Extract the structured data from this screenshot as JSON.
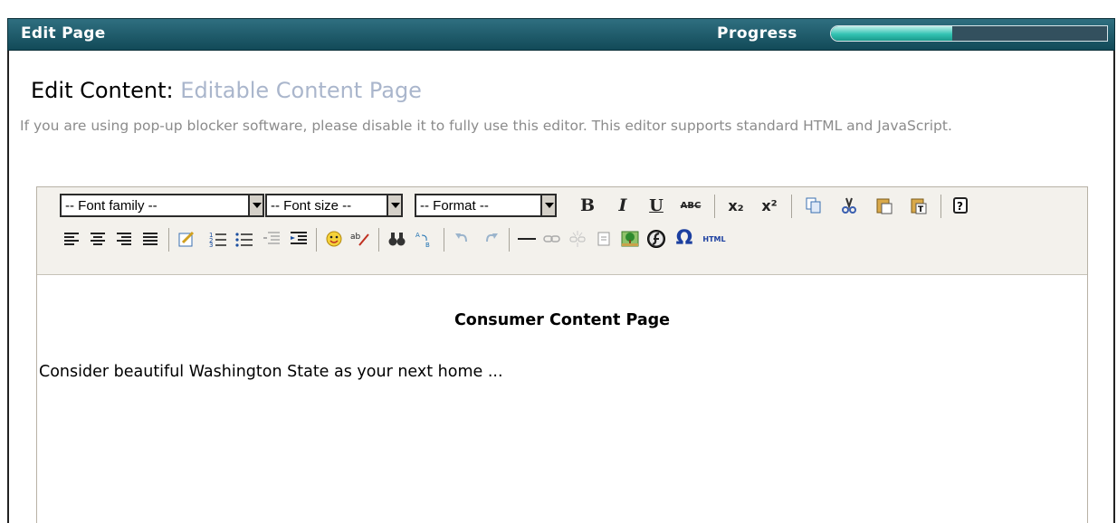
{
  "header": {
    "title": "Edit Page",
    "progress_label": "Progress",
    "progress_fraction": 0.44
  },
  "page": {
    "heading_label": "Edit Content:",
    "heading_page": "Editable Content Page",
    "notice": "If you are using pop-up blocker software, please disable it to fully use this editor. This editor supports standard HTML and JavaScript."
  },
  "toolbar": {
    "font_family": "-- Font family --",
    "font_size": "-- Font size --",
    "format": "-- Format --",
    "icons_row1": [
      "bold",
      "italic",
      "underline",
      "strikethrough",
      "subscript",
      "superscript",
      "copy",
      "cut",
      "paste",
      "paste-text",
      "help"
    ],
    "icons_row2": [
      "align-left",
      "align-center",
      "align-right",
      "justify",
      "cleanup",
      "numbered-list",
      "bullet-list",
      "outdent",
      "indent",
      "emotions",
      "spellcheck",
      "find",
      "replace",
      "undo",
      "redo",
      "horizontal-rule",
      "link",
      "unlink",
      "anchor",
      "image",
      "flash",
      "special-char",
      "html-source"
    ],
    "glyphs": {
      "bold": "B",
      "italic": "I",
      "underline": "U",
      "strikethrough": "ABC",
      "subscript": "x₂",
      "superscript": "x²",
      "omega": "Ω",
      "html": "HTML"
    }
  },
  "editor_content": {
    "heading": "Consumer Content Page",
    "paragraph": "Consider beautiful Washington State as your next home ..."
  }
}
